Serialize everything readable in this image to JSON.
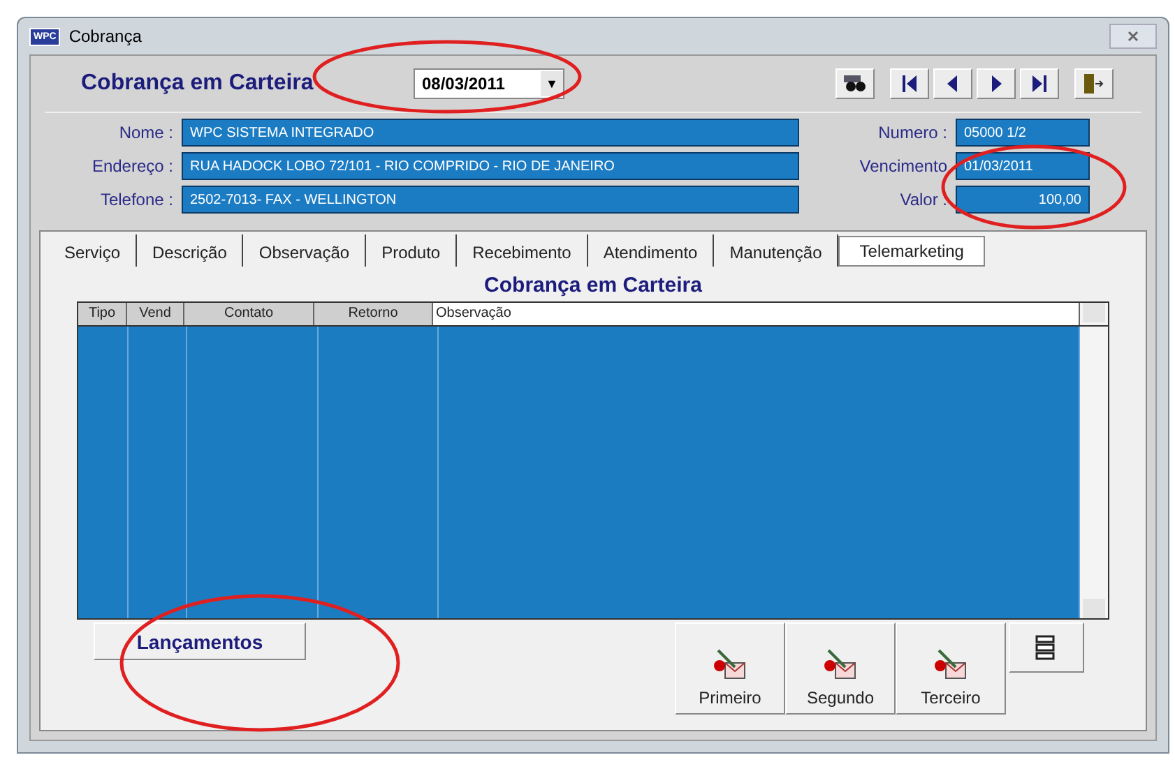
{
  "window": {
    "title": "Cobrança",
    "logo": "WPC"
  },
  "header": {
    "title": "Cobrança em Carteira",
    "date": "08/03/2011",
    "dropdown_arrow": "▼"
  },
  "fields_left": [
    {
      "label": "Nome :",
      "value": "WPC SISTEMA INTEGRADO"
    },
    {
      "label": "Endereço :",
      "value": "RUA HADOCK LOBO 72/101 - RIO COMPRIDO - RIO DE JANEIRO"
    },
    {
      "label": "Telefone :",
      "value": "2502-7013- FAX - WELLINGTON"
    }
  ],
  "fields_right": [
    {
      "label": "Numero :",
      "value": "05000 1/2",
      "kind": "text"
    },
    {
      "label": "Vencimento",
      "value": "01/03/2011",
      "kind": "text"
    },
    {
      "label": "Valor :",
      "value": "100,00",
      "kind": "amount"
    }
  ],
  "tabs": [
    {
      "label": "Serviço",
      "selected": false
    },
    {
      "label": "Descrição",
      "selected": false
    },
    {
      "label": "Observação",
      "selected": false
    },
    {
      "label": "Produto",
      "selected": false
    },
    {
      "label": "Recebimento",
      "selected": false
    },
    {
      "label": "Atendimento",
      "selected": false
    },
    {
      "label": "Manutenção",
      "selected": false
    },
    {
      "label": "Telemarketing",
      "selected": true
    }
  ],
  "panel_title": "Cobrança em Carteira",
  "table": {
    "columns": [
      "Tipo",
      "Vend",
      "Contato",
      "Retorno",
      "Observação"
    ]
  },
  "lancamentos_button": "Lançamentos",
  "action_buttons": [
    "Primeiro",
    "Segundo",
    "Terceiro"
  ]
}
